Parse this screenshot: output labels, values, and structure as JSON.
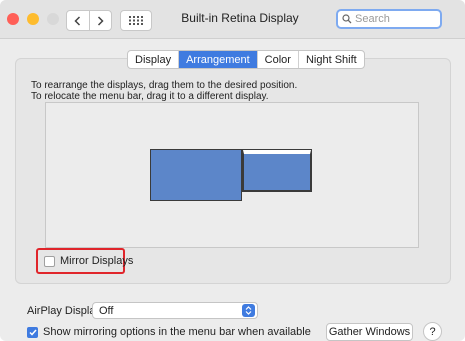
{
  "window": {
    "title": "Built-in Retina Display",
    "search_placeholder": "Search"
  },
  "toolbar": {
    "back_icon": "chevron-left-icon",
    "forward_icon": "chevron-right-icon",
    "grid_icon": "grid-icon"
  },
  "tabs": [
    {
      "label": "Display",
      "active": false
    },
    {
      "label": "Arrangement",
      "active": true
    },
    {
      "label": "Color",
      "active": false
    },
    {
      "label": "Night Shift",
      "active": false
    }
  ],
  "instructions": {
    "line1": "To rearrange the displays, drag them to the desired position.",
    "line2": "To relocate the menu bar, drag it to a different display."
  },
  "mirror": {
    "label": "Mirror Displays",
    "checked": false,
    "highlight_color": "#e0252b"
  },
  "airplay": {
    "label": "AirPlay Display:",
    "value": "Off"
  },
  "show_mirroring": {
    "label": "Show mirroring options in the menu bar when available",
    "checked": true
  },
  "buttons": {
    "gather": "Gather Windows",
    "help": "?"
  },
  "colors": {
    "accent": "#3f7be0",
    "display_fill": "#5c86c9"
  }
}
